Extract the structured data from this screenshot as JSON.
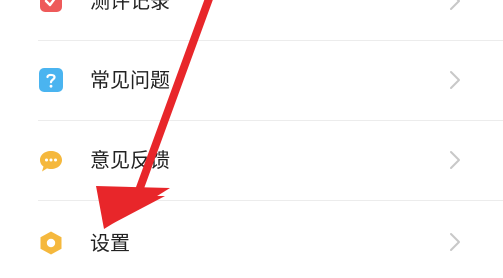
{
  "menu": {
    "items": [
      {
        "label": "测评记录",
        "icon": "record-icon",
        "color": "#ee5a5a"
      },
      {
        "label": "常见问题",
        "icon": "question-icon",
        "color": "#4ab4f0"
      },
      {
        "label": "意见反馈",
        "icon": "feedback-icon",
        "color": "#f5b83d"
      },
      {
        "label": "设置",
        "icon": "settings-icon",
        "color": "#f5b83d"
      }
    ]
  },
  "colors": {
    "annotation_arrow": "#e8262a",
    "chevron": "#c8c8c8",
    "divider": "#ececec"
  }
}
